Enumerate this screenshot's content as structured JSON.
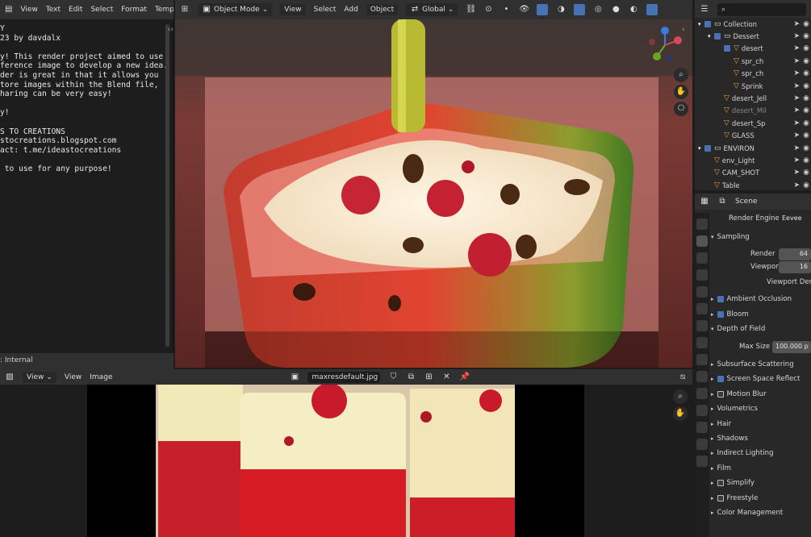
{
  "text_editor": {
    "menu": [
      "View",
      "Text",
      "Edit",
      "Select",
      "Format",
      "Templates"
    ],
    "lines": [
      "Y",
      "23 by davdalx",
      "",
      "y! This render project aimed to use",
      "ference image to develop a new idea.",
      "der is great in that it allows you",
      "tore images within the Blend file,",
      "haring can be very easy!",
      "",
      "y!",
      "",
      "S TO CREATIONS",
      "stocreations.blogspot.com",
      "act: t.me/ideastocreations",
      "",
      " to use for any purpose!"
    ],
    "footer": ": Internal"
  },
  "viewport": {
    "mode": "Object Mode",
    "menu": [
      "View",
      "Select",
      "Add",
      "Object"
    ],
    "orientation": "Global"
  },
  "outliner": {
    "search_placeholder": "",
    "rows": [
      {
        "label": "Collection",
        "indent": 0,
        "type": "collection"
      },
      {
        "label": "Dessert",
        "indent": 1,
        "type": "collection"
      },
      {
        "label": "desert",
        "indent": 2,
        "type": "object"
      },
      {
        "label": "spr_ch",
        "indent": 3,
        "type": "object"
      },
      {
        "label": "spr_ch",
        "indent": 3,
        "type": "object"
      },
      {
        "label": "Sprink",
        "indent": 3,
        "type": "object"
      },
      {
        "label": "desert_Jell",
        "indent": 2,
        "type": "object"
      },
      {
        "label": "desert_Mil",
        "indent": 2,
        "type": "object"
      },
      {
        "label": "desert_Sp",
        "indent": 2,
        "type": "object"
      },
      {
        "label": "GLASS",
        "indent": 2,
        "type": "object"
      },
      {
        "label": "ENVIRON",
        "indent": 0,
        "type": "collection"
      },
      {
        "label": "env_Light",
        "indent": 1,
        "type": "object"
      },
      {
        "label": "CAM_SHOT",
        "indent": 1,
        "type": "object"
      },
      {
        "label": "Table",
        "indent": 1,
        "type": "object"
      }
    ]
  },
  "properties": {
    "context": "Scene",
    "render_engine_label": "Render Engine",
    "render_engine": "Eevee",
    "sampling": "Sampling",
    "render_label": "Render",
    "render_value": "64",
    "viewport_label": "Viewport",
    "viewport_value": "16",
    "viewport_denoise": "Viewport Denc",
    "panels": [
      {
        "label": "Ambient Occlusion",
        "check": true
      },
      {
        "label": "Bloom",
        "check": true
      },
      {
        "label": "Depth of Field",
        "open": true
      }
    ],
    "max_size_label": "Max Size",
    "max_size_value": "100.000 p",
    "panels2": [
      {
        "label": "Subsurface Scattering"
      },
      {
        "label": "Screen Space Reflect",
        "check": true
      },
      {
        "label": "Motion Blur",
        "check": false
      },
      {
        "label": "Volumetrics"
      },
      {
        "label": "Hair"
      },
      {
        "label": "Shadows"
      },
      {
        "label": "Indirect Lighting"
      },
      {
        "label": "Film"
      },
      {
        "label": "Simplify",
        "check": false
      },
      {
        "label": "Freestyle",
        "check": false
      },
      {
        "label": "Color Management"
      }
    ]
  },
  "image_editor": {
    "menu": [
      "View",
      "View",
      "Image"
    ],
    "image_name": "maxresdefault.jpg"
  }
}
